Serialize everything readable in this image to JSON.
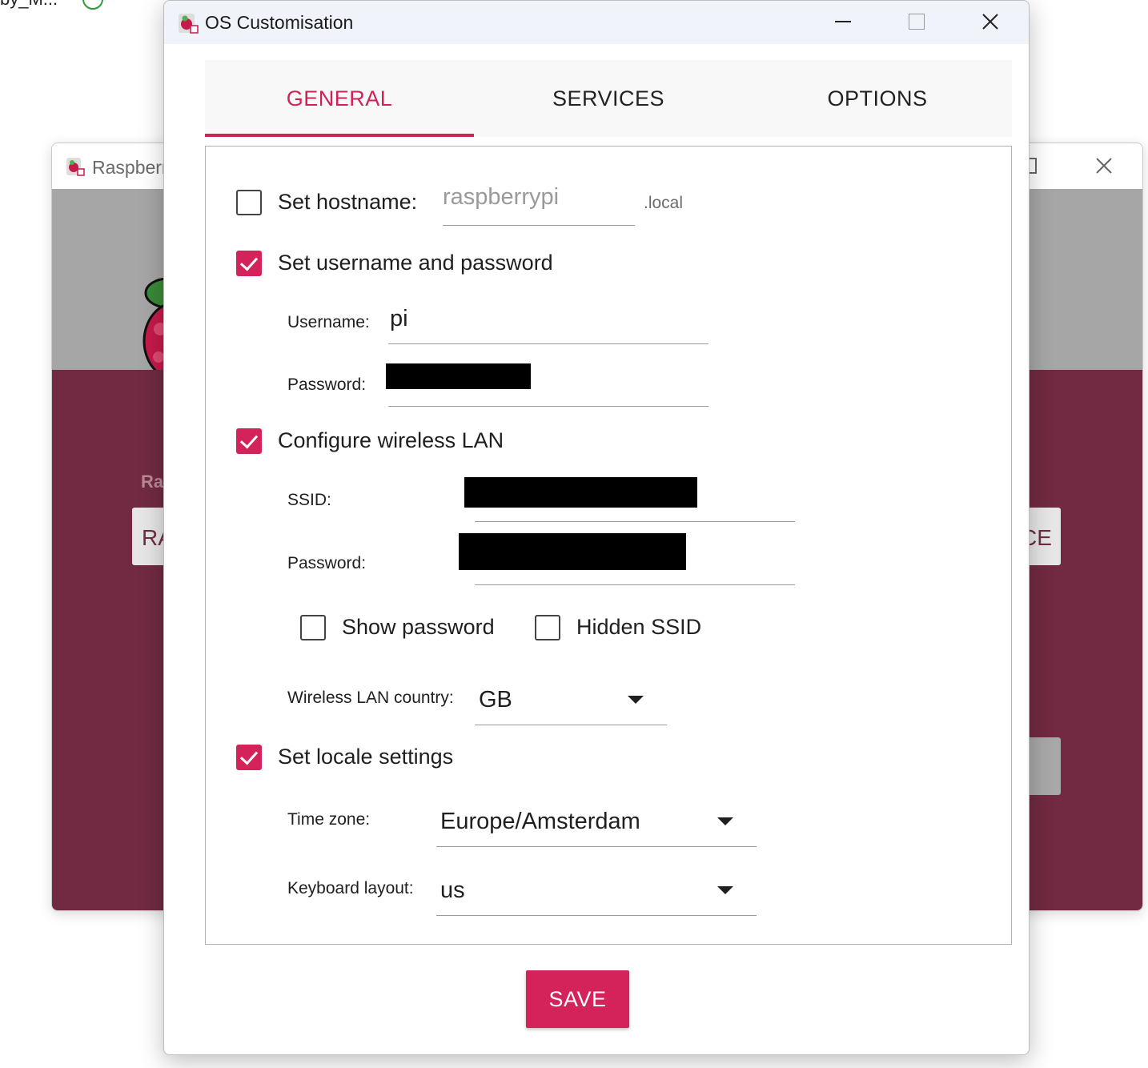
{
  "desktop": {
    "truncated_text": "by_M..."
  },
  "background_window": {
    "title": "Raspberr",
    "label_partial": "Ra",
    "left_button_partial": "RA",
    "right_button_partial": "CE"
  },
  "dialog": {
    "title": "OS Customisation",
    "tabs": [
      {
        "label": "GENERAL",
        "active": true
      },
      {
        "label": "SERVICES",
        "active": false
      },
      {
        "label": "OPTIONS",
        "active": false
      }
    ],
    "hostname": {
      "label": "Set hostname:",
      "checked": false,
      "placeholder": "raspberrypi",
      "suffix": ".local"
    },
    "user": {
      "label": "Set username and password",
      "checked": true,
      "username_label": "Username:",
      "username_value": "pi",
      "password_label": "Password:"
    },
    "wifi": {
      "label": "Configure wireless LAN",
      "checked": true,
      "ssid_label": "SSID:",
      "password_label": "Password:",
      "show_password_label": "Show password",
      "show_password_checked": false,
      "hidden_ssid_label": "Hidden SSID",
      "hidden_ssid_checked": false,
      "country_label": "Wireless LAN country:",
      "country_value": "GB"
    },
    "locale": {
      "label": "Set locale settings",
      "checked": true,
      "timezone_label": "Time zone:",
      "timezone_value": "Europe/Amsterdam",
      "keyboard_label": "Keyboard layout:",
      "keyboard_value": "us"
    },
    "save_label": "SAVE"
  },
  "colors": {
    "accent": "#d4225a",
    "background_maroon": "#712a41",
    "titlebar": "#f0f3f9"
  },
  "icons": [
    "raspberry-pi-app-icon",
    "minimize-icon",
    "maximize-icon",
    "close-icon",
    "chevron-down-icon",
    "checkmark-icon"
  ]
}
